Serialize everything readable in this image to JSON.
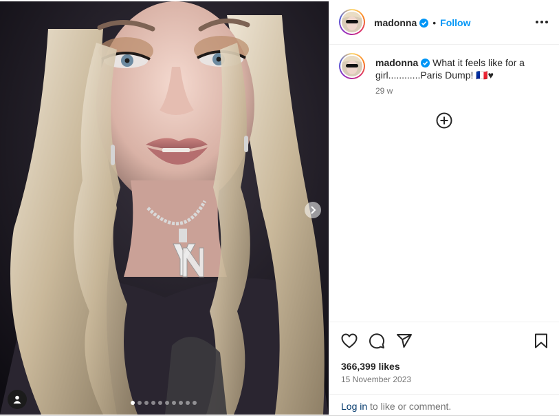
{
  "post": {
    "username": "madonna",
    "follow_label": "Follow",
    "separator": "•",
    "caption_text": "What it feels like for a girl............Paris Dump! 🇫🇷♥",
    "time_ago": "29 w",
    "likes": "366,399 likes",
    "date": "15 November 2023"
  },
  "media": {
    "carousel_count": 10,
    "carousel_active_index": 0
  },
  "footer": {
    "login_link": "Log in",
    "login_suffix": " to like or comment."
  },
  "colors": {
    "follow": "#0095f6",
    "link": "#00376b",
    "muted": "#737373"
  },
  "icons": [
    "verified-badge-icon",
    "more-options-icon",
    "add-comment-icon",
    "heart-icon",
    "comment-icon",
    "share-icon",
    "bookmark-icon",
    "carousel-next-icon",
    "user-tag-icon"
  ]
}
